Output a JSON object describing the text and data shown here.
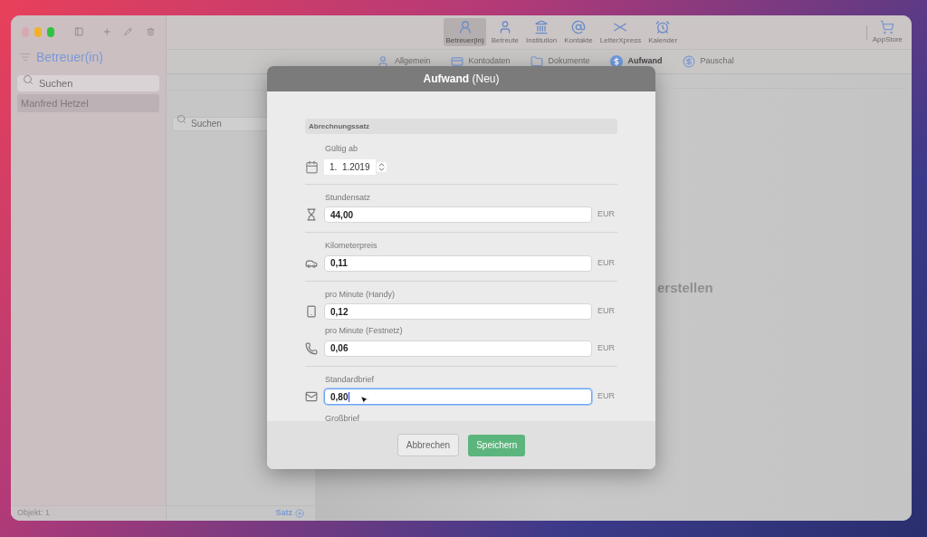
{
  "sidebar": {
    "title": "Betreuer(in)",
    "search_placeholder": "Suchen",
    "items": [
      {
        "label": "Manfred Hetzel",
        "selected": true
      }
    ],
    "status": "Objekt: 1"
  },
  "toolbar": {
    "items": [
      {
        "label": "Betreuer(in)",
        "selected": true
      },
      {
        "label": "Betreute",
        "selected": false
      },
      {
        "label": "Institution",
        "selected": false
      },
      {
        "label": "Kontakte",
        "selected": false
      },
      {
        "label": "LetterXpress",
        "selected": false
      },
      {
        "label": "Kalender",
        "selected": false
      }
    ],
    "store": "AppStore"
  },
  "tabs": [
    {
      "label": "Allgemein",
      "selected": false
    },
    {
      "label": "Kontodaten",
      "selected": false
    },
    {
      "label": "Dokumente",
      "selected": false
    },
    {
      "label": "Aufwand",
      "selected": true
    },
    {
      "label": "Pauschal",
      "selected": false
    }
  ],
  "list": {
    "search_placeholder": "Suchen",
    "add_label": "Satz"
  },
  "content": {
    "hint": "erstellen"
  },
  "dialog": {
    "title": "Aufwand",
    "title_suffix": "(Neu)",
    "section": "Abrechnungssatz",
    "date": {
      "label": "Gültig ab",
      "value": "1.  1.2019"
    },
    "groups": [
      [
        {
          "label": "Stundensatz",
          "value": "44,00",
          "unit": "EUR",
          "focused": false
        }
      ],
      [
        {
          "label": "Kilometerpreis",
          "value": "0,11",
          "unit": "EUR",
          "focused": false
        }
      ],
      [
        {
          "label": "pro Minute (Handy)",
          "value": "0,12",
          "unit": "EUR",
          "focused": false
        },
        {
          "label": "pro Minute (Festnetz)",
          "value": "0,06",
          "unit": "EUR",
          "focused": false
        }
      ],
      [
        {
          "label": "Standardbrief",
          "value": "0,80",
          "unit": "EUR",
          "focused": true
        }
      ]
    ],
    "cut_label": "Großbrief",
    "buttons": [
      {
        "label": "Abbrechen",
        "kind": "secondary"
      },
      {
        "label": "Speichern",
        "kind": "primary"
      }
    ]
  }
}
